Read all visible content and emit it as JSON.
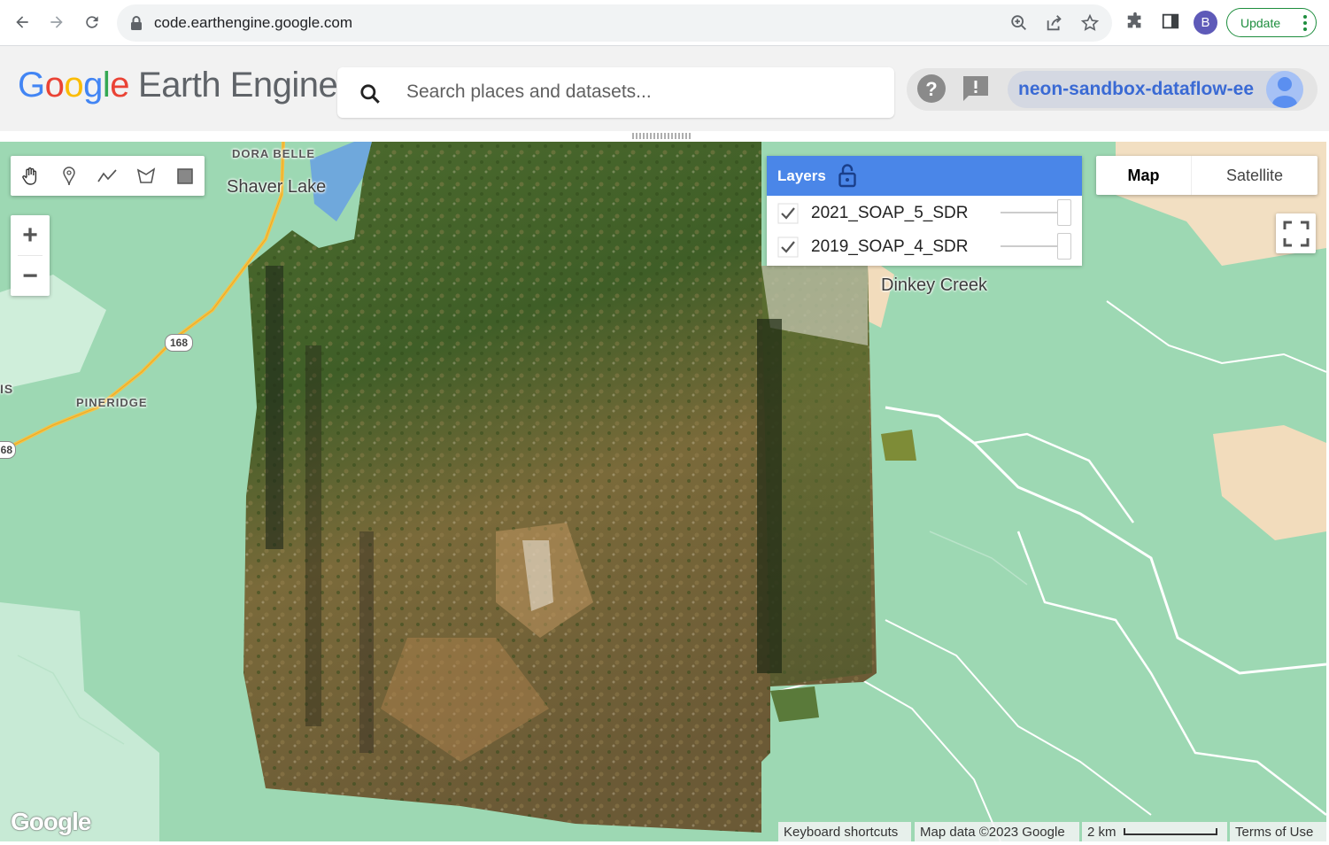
{
  "browser": {
    "url": "code.earthengine.google.com",
    "profile_initial": "B",
    "update_label": "Update",
    "icons": [
      "back-icon",
      "forward-icon",
      "reload-icon",
      "lock-icon",
      "zoom-icon",
      "share-icon",
      "star-icon",
      "extensions-icon",
      "sidepanel-icon",
      "more-vert-icon"
    ]
  },
  "header": {
    "logo_google": [
      "G",
      "o",
      "o",
      "g",
      "l",
      "e"
    ],
    "logo_product": "Earth Engine",
    "search_placeholder": "Search places and datasets...",
    "project": "neon-sandbox-dataflow-ee",
    "icons": [
      "search-icon",
      "help-icon",
      "feedback-icon",
      "user-avatar"
    ]
  },
  "map": {
    "toolbar": [
      "hand-icon",
      "marker-icon",
      "line-icon",
      "polygon-icon",
      "rectangle-icon"
    ],
    "zoom_in": "+",
    "zoom_out": "−",
    "labels": {
      "dora_belle": "DORA BELLE",
      "shaver_lake": "Shaver Lake",
      "pineridge": "PINERIDGE",
      "dinkey_creek": "Dinkey Creek",
      "route_168": "168",
      "route_168_edge": "68",
      "edge_text": "IS"
    },
    "layers": {
      "title": "Layers",
      "items": [
        {
          "name": "2021_SOAP_5_SDR",
          "checked": true,
          "opacity": 1.0
        },
        {
          "name": "2019_SOAP_4_SDR",
          "checked": true,
          "opacity": 1.0
        }
      ]
    },
    "map_types": {
      "map": "Map",
      "satellite": "Satellite",
      "selected": "Map"
    },
    "watermark": "Google",
    "attribution": {
      "keyboard": "Keyboard shortcuts",
      "mapdata": "Map data ©2023 Google",
      "scale": "2 km",
      "terms": "Terms of Use"
    },
    "colors": {
      "forest": "#9dd8b3",
      "land": "#d8f0e0",
      "water": "#6fa8dc",
      "accent": "#4a86e8"
    }
  }
}
